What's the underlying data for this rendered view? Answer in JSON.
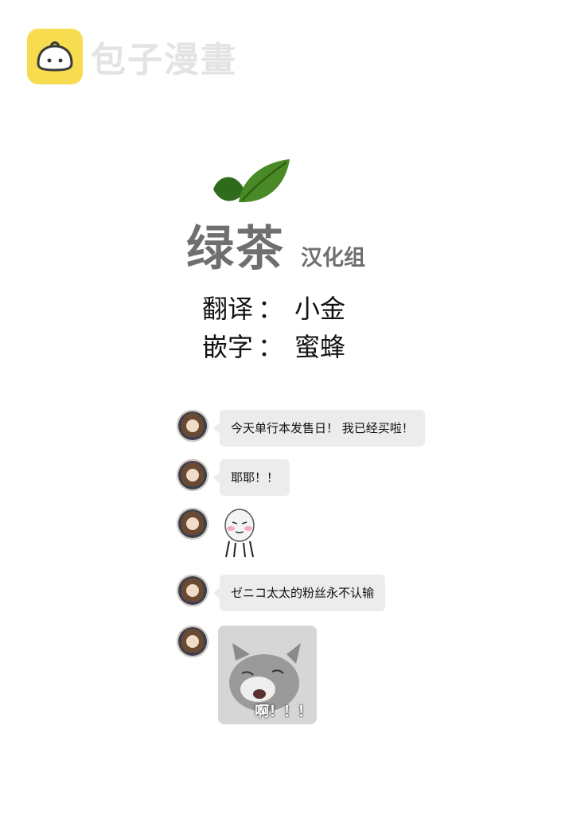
{
  "watermark": {
    "icon": "bun-logo-icon",
    "text": "包子漫畫",
    "color": "#f6dc4e"
  },
  "group": {
    "name": "绿茶",
    "suffix": "汉化组",
    "icon": "leaf-icon",
    "leaf_color": "#3f7a1e"
  },
  "credits": [
    {
      "label": "翻译",
      "sep": "：",
      "value": "小金"
    },
    {
      "label": "嵌字",
      "sep": "：",
      "value": "蜜蜂"
    }
  ],
  "chat": {
    "messages": [
      {
        "type": "text",
        "text": "今天单行本发售日！ 我已经买啦！"
      },
      {
        "type": "text",
        "text": "耶耶！！"
      },
      {
        "type": "sticker",
        "sticker": "blushing-face-sticker"
      },
      {
        "type": "text",
        "text": "ゼニコ太太的粉丝永不认输"
      },
      {
        "type": "sticker",
        "sticker": "crying-cat-sticker",
        "caption": "啊！！！"
      }
    ],
    "bubble_color": "#ececec"
  }
}
